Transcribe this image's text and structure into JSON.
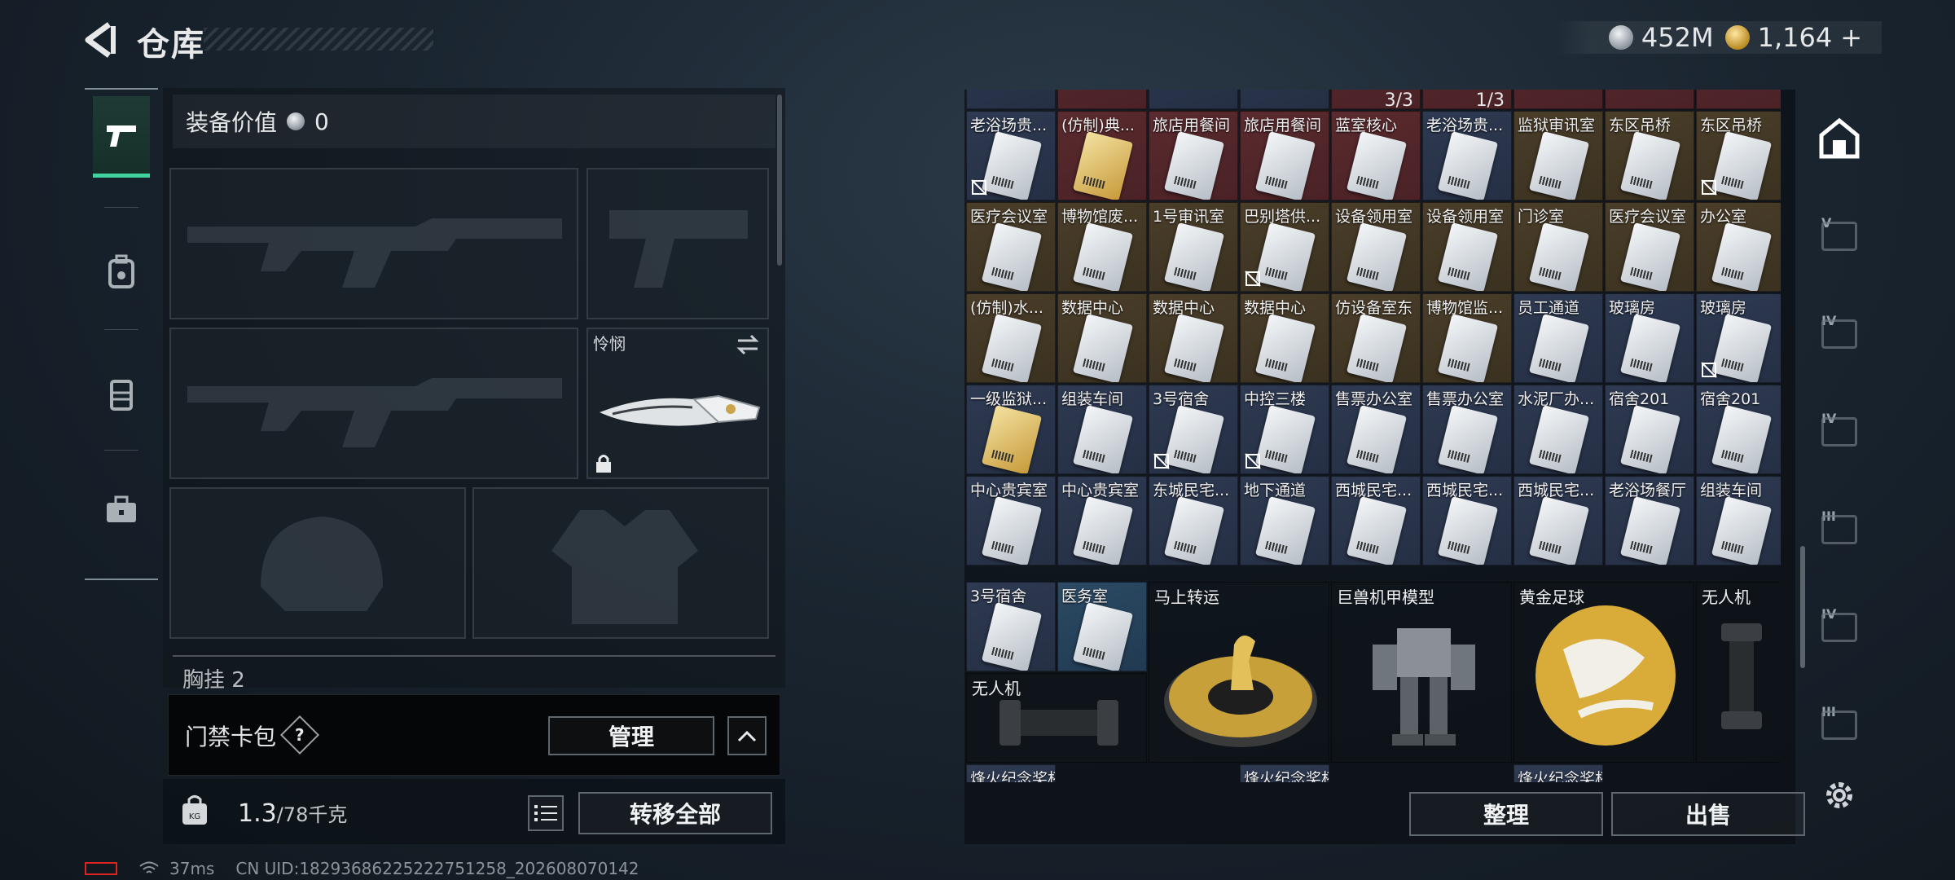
{
  "header": {
    "title": "仓库",
    "currency": [
      {
        "icon": "silver-coin-icon",
        "value": "452M"
      },
      {
        "icon": "gold-coin-icon",
        "value": "1,164"
      }
    ],
    "add_label": "+"
  },
  "rail": {
    "tabs": [
      {
        "icon": "pistol-icon",
        "active": true
      },
      {
        "icon": "backpack-icon",
        "active": false
      },
      {
        "icon": "vest-icon",
        "active": false
      },
      {
        "icon": "toolbox-icon",
        "active": false
      }
    ]
  },
  "equipment": {
    "value_label": "装备价值",
    "value": "0",
    "melee_name": "怜悯",
    "pouch_label": "胸挂",
    "pouch_count": "2"
  },
  "card_wallet": {
    "label": "门禁卡包",
    "help": "?",
    "manage": "管理"
  },
  "capacity": {
    "current": "1.3",
    "max": "/78千克",
    "transfer_all": "转移全部"
  },
  "status": {
    "ping": "37ms",
    "uid": "CN UID:18293686225222751258_202608070142"
  },
  "stash": {
    "top_counts": [
      "3/3",
      "1/3"
    ],
    "rows": [
      [
        "老浴场贵...",
        "(仿制)典...",
        "旅店用餐间",
        "旅店用餐间",
        "蓝室核心",
        "老浴场贵...",
        "监狱审讯室",
        "东区吊桥",
        "东区吊桥"
      ],
      [
        "医疗会议室",
        "博物馆废...",
        "1号审讯室",
        "巴别塔供...",
        "设备领用室",
        "设备领用室",
        "门诊室",
        "医疗会议室",
        "办公室"
      ],
      [
        "(仿制)水...",
        "数据中心",
        "数据中心",
        "数据中心",
        "仿设备室东",
        "博物馆监...",
        "员工通道",
        "玻璃房",
        "玻璃房"
      ],
      [
        "一级监狱...",
        "组装车间",
        "3号宿舍",
        "中控三楼",
        "售票办公室",
        "售票办公室",
        "水泥厂办...",
        "宿舍201",
        "宿舍201"
      ],
      [
        "中心贵宾室",
        "中心贵宾室",
        "东城民宅...",
        "地下通道",
        "西城民宅...",
        "西城民宅...",
        "西城民宅...",
        "老浴场餐厅",
        "组装车间"
      ]
    ],
    "row6_small": [
      "3号宿舍",
      "医务室"
    ],
    "big_items": [
      "马上转运",
      "巨兽机甲模型",
      "黄金足球",
      "无人机"
    ],
    "drone_2": "无人机",
    "cut_labels": [
      "烽火纪念奖杯",
      "烽火纪念奖杯",
      "烽火纪念奖杯"
    ],
    "sort": "整理",
    "sell": "出售"
  },
  "sidebar_right": {
    "roman": [
      "V",
      "IV",
      "IV",
      "III",
      "IV",
      "III"
    ]
  }
}
